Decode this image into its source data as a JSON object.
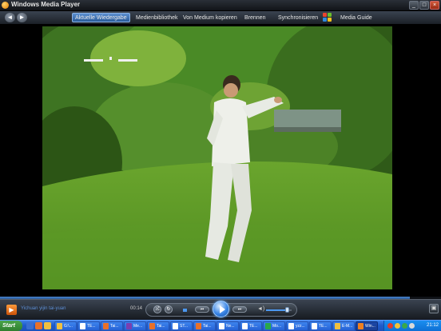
{
  "window": {
    "title": "Windows Media Player",
    "buttons": {
      "minimize": "_",
      "maximize": "□",
      "close": "×"
    }
  },
  "nav": {
    "back": "◄",
    "forward": "►",
    "tabs": [
      {
        "label": "Aktuelle Wiedergabe",
        "active": true
      },
      {
        "label": "Medienbibliothek",
        "active": false
      },
      {
        "label": "Von Medium kopieren",
        "active": false
      },
      {
        "label": "Brennen",
        "active": false
      },
      {
        "label": "Synchronisieren",
        "active": false
      },
      {
        "label": "Media Guide",
        "active": false
      }
    ]
  },
  "playback": {
    "now_playing_icon": "media-player-icon",
    "now_playing_text": "Yichuan yijin tai-yuan",
    "time": "00:14",
    "progress": 0.93,
    "volume": 0.85,
    "buttons": {
      "shuffle": "⤮",
      "repeat": "↻",
      "prev": "⏮",
      "next": "⏭",
      "mute": "◄)",
      "mini_mode": "▣"
    }
  },
  "taskbar": {
    "start_label": "Start",
    "quick_launch": [
      "show-desktop-icon",
      "firefox-icon",
      "outlook-icon"
    ],
    "buttons": [
      {
        "label": "G:\\...",
        "icon": "folder-icon",
        "color": "#f0c040",
        "active": false
      },
      {
        "label": "TE...",
        "icon": "word-icon",
        "color": "#ffffff",
        "active": false
      },
      {
        "label": "Tai...",
        "icon": "firefox-icon",
        "color": "#e8702a",
        "active": false
      },
      {
        "label": "Me...",
        "icon": "media-icon",
        "color": "#7a3fb0",
        "active": false
      },
      {
        "label": "Tai...",
        "icon": "firefox-icon",
        "color": "#e8702a",
        "active": false
      },
      {
        "label": "ST...",
        "icon": "word-icon",
        "color": "#ffffff",
        "active": false
      },
      {
        "label": "Tai...",
        "icon": "firefox-icon",
        "color": "#e8702a",
        "active": false
      },
      {
        "label": "Ne...",
        "icon": "word-icon",
        "color": "#ffffff",
        "active": false
      },
      {
        "label": "TE...",
        "icon": "word-icon",
        "color": "#ffffff",
        "active": false
      },
      {
        "label": "Mo...",
        "icon": "chat-icon",
        "color": "#2aa84a",
        "active": false
      },
      {
        "label": "yzz...",
        "icon": "word-icon",
        "color": "#ffffff",
        "active": false
      },
      {
        "label": "TE...",
        "icon": "word-icon",
        "color": "#ffffff",
        "active": false
      },
      {
        "label": "E-M...",
        "icon": "mail-icon",
        "color": "#f0c040",
        "active": false
      },
      {
        "label": "Win...",
        "icon": "media-icon",
        "color": "#f08020",
        "active": true
      }
    ],
    "clock": "21:12"
  },
  "colors": {
    "accent": "#3b86e6",
    "taskbar_blue": "#1f5bcc",
    "tray_blue": "#0e6fd5",
    "start_green": "#3a913a"
  }
}
